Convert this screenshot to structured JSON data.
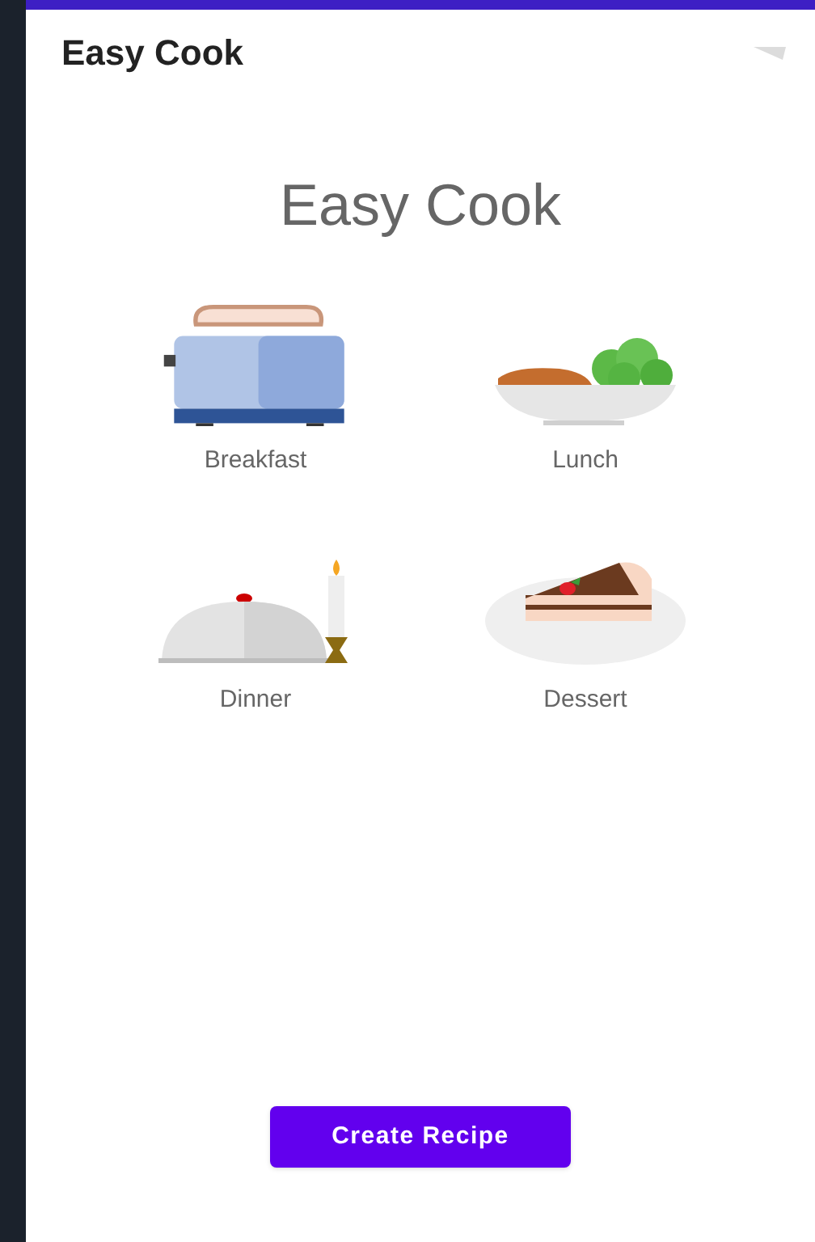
{
  "app_bar": {
    "title": "Easy Cook"
  },
  "heading": "Easy Cook",
  "categories": [
    {
      "kind": "toaster",
      "label": "Breakfast"
    },
    {
      "kind": "plate",
      "label": "Lunch"
    },
    {
      "kind": "cloche",
      "label": "Dinner"
    },
    {
      "kind": "cake",
      "label": "Dessert"
    }
  ],
  "button": "Create Recipe"
}
